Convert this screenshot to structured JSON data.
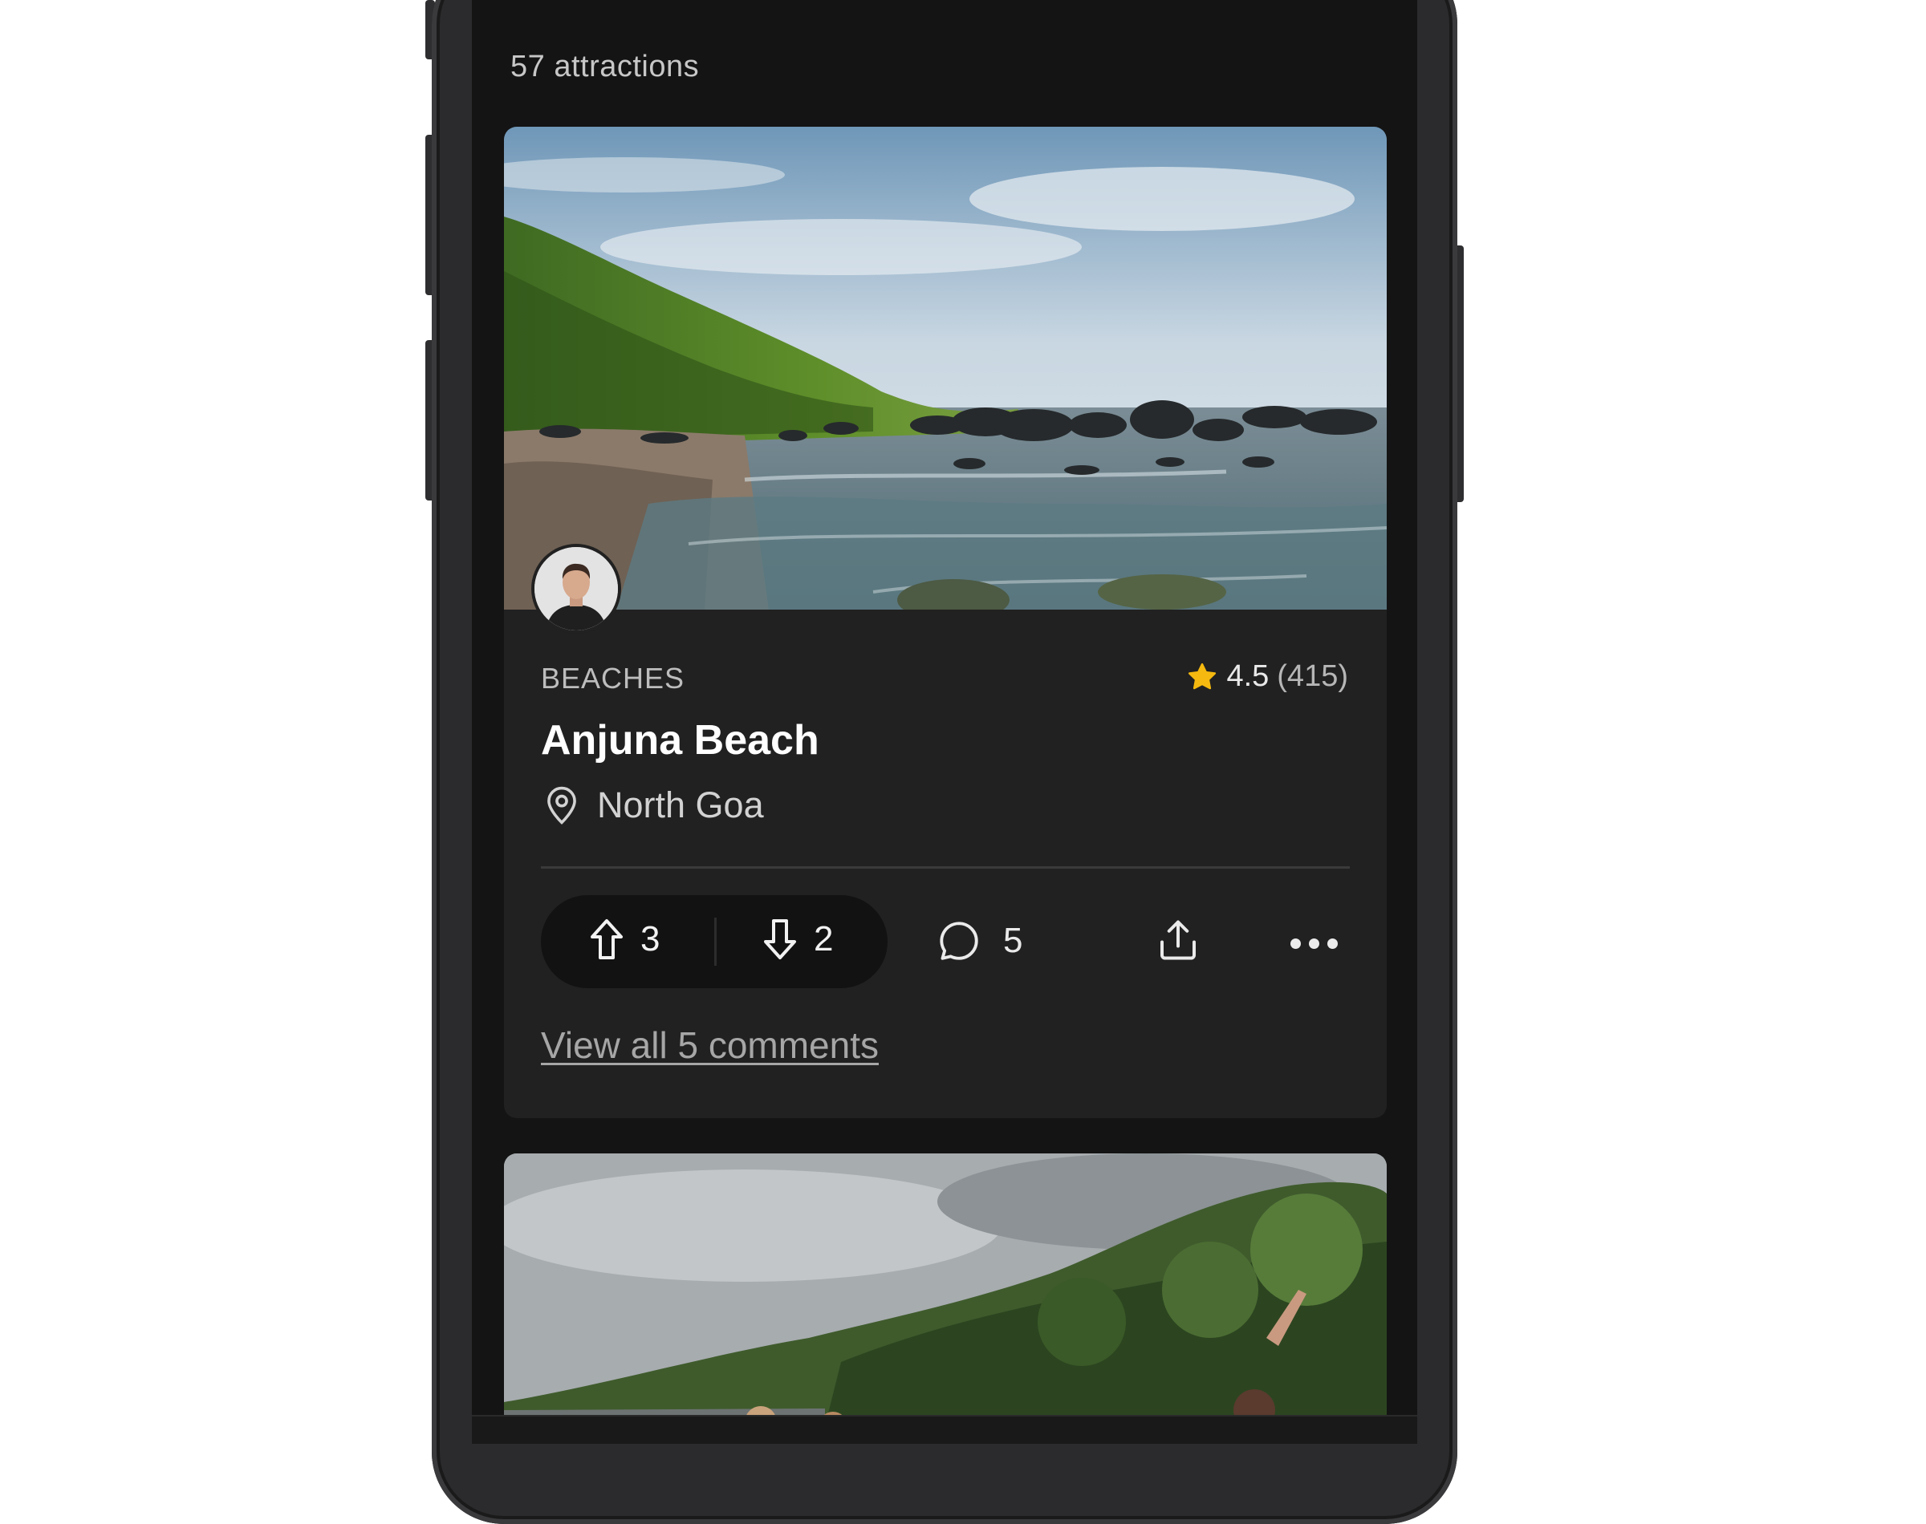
{
  "listing": {
    "count_label": "57 attractions"
  },
  "card": {
    "image_icon": "beach-photo",
    "avatar_icon": "user-avatar",
    "category": "BEACHES",
    "rating": {
      "icon": "star-icon",
      "value": "4.5",
      "count": "(415)",
      "star_color": "#F5B90F"
    },
    "title": "Anjuna Beach",
    "location": {
      "icon": "location-pin-icon",
      "text": "North Goa"
    },
    "actions": {
      "upvote": {
        "icon": "arrow-up-icon",
        "count": "3"
      },
      "downvote": {
        "icon": "arrow-down-icon",
        "count": "2"
      },
      "comments": {
        "icon": "comment-icon",
        "count": "5"
      },
      "share": {
        "icon": "share-icon"
      },
      "more": {
        "icon": "more-dots-icon"
      }
    },
    "view_comments_label": "View all 5 comments"
  },
  "next_card": {
    "image_icon": "trekking-group-photo"
  }
}
